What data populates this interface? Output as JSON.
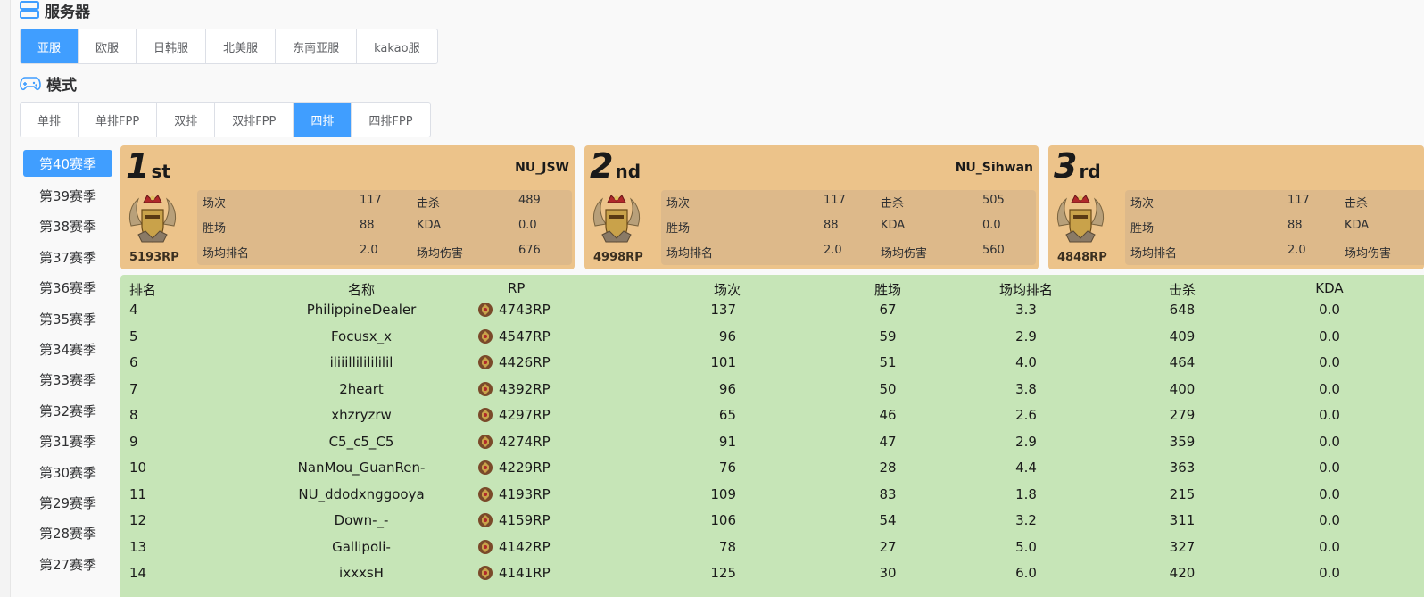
{
  "server": {
    "title": "服务器",
    "icon": "server-icon",
    "options": [
      "亚服",
      "欧服",
      "日韩服",
      "北美服",
      "东南亚服",
      "kakao服"
    ],
    "selected": "亚服"
  },
  "mode": {
    "title": "模式",
    "icon": "gamepad-icon",
    "options": [
      "单排",
      "单排FPP",
      "双排",
      "双排FPP",
      "四排",
      "四排FPP"
    ],
    "selected": "四排"
  },
  "seasons": {
    "items": [
      "第40赛季",
      "第39赛季",
      "第38赛季",
      "第37赛季",
      "第36赛季",
      "第35赛季",
      "第34赛季",
      "第33赛季",
      "第32赛季",
      "第31赛季",
      "第30赛季",
      "第29赛季",
      "第28赛季",
      "第27赛季"
    ],
    "selected": "第40赛季"
  },
  "podium": [
    {
      "place": "1",
      "suffix": "st",
      "name": "NU_JSW",
      "rp": "5193RP",
      "labels": {
        "matches": "场次",
        "wins": "胜场",
        "avg_rank": "场均排名",
        "kills": "击杀",
        "kda": "KDA",
        "avg_damage": "场均伤害"
      },
      "matches": "117",
      "wins": "88",
      "avg_rank": "2.0",
      "kills": "489",
      "kda": "0.0",
      "avg_damage": "676"
    },
    {
      "place": "2",
      "suffix": "nd",
      "name": "NU_Sihwan",
      "rp": "4998RP",
      "labels": {
        "matches": "场次",
        "wins": "胜场",
        "avg_rank": "场均排名",
        "kills": "击杀",
        "kda": "KDA",
        "avg_damage": "场均伤害"
      },
      "matches": "117",
      "wins": "88",
      "avg_rank": "2.0",
      "kills": "505",
      "kda": "0.0",
      "avg_damage": "560"
    },
    {
      "place": "3",
      "suffix": "rd",
      "name": "",
      "rp": "4848RP",
      "labels": {
        "matches": "场次",
        "wins": "胜场",
        "avg_rank": "场均排名",
        "kills": "击杀",
        "kda": "KDA",
        "avg_damage": "场均伤害"
      },
      "matches": "117",
      "wins": "88",
      "avg_rank": "2.0",
      "kills": "",
      "kda": "",
      "avg_damage": ""
    }
  ],
  "table": {
    "headers": {
      "rank": "排名",
      "name": "名称",
      "rp": "RP",
      "matches": "场次",
      "wins": "胜场",
      "avg_rank": "场均排名",
      "kills": "击杀",
      "kda": "KDA"
    },
    "rows": [
      {
        "rank": "4",
        "name": "PhilippineDealer",
        "rp": "4743RP",
        "matches": "137",
        "wins": "67",
        "avg_rank": "3.3",
        "kills": "648",
        "kda": "0.0"
      },
      {
        "rank": "5",
        "name": "Focusx_x",
        "rp": "4547RP",
        "matches": "96",
        "wins": "59",
        "avg_rank": "2.9",
        "kills": "409",
        "kda": "0.0"
      },
      {
        "rank": "6",
        "name": "iliiillililililil",
        "rp": "4426RP",
        "matches": "101",
        "wins": "51",
        "avg_rank": "4.0",
        "kills": "464",
        "kda": "0.0"
      },
      {
        "rank": "7",
        "name": "2heart",
        "rp": "4392RP",
        "matches": "96",
        "wins": "50",
        "avg_rank": "3.8",
        "kills": "400",
        "kda": "0.0"
      },
      {
        "rank": "8",
        "name": "xhzryzrw",
        "rp": "4297RP",
        "matches": "65",
        "wins": "46",
        "avg_rank": "2.6",
        "kills": "279",
        "kda": "0.0"
      },
      {
        "rank": "9",
        "name": "C5_c5_C5",
        "rp": "4274RP",
        "matches": "91",
        "wins": "47",
        "avg_rank": "2.9",
        "kills": "359",
        "kda": "0.0"
      },
      {
        "rank": "10",
        "name": "NanMou_GuanRen-",
        "rp": "4229RP",
        "matches": "76",
        "wins": "28",
        "avg_rank": "4.4",
        "kills": "363",
        "kda": "0.0"
      },
      {
        "rank": "11",
        "name": "NU_ddodxnggooya",
        "rp": "4193RP",
        "matches": "109",
        "wins": "83",
        "avg_rank": "1.8",
        "kills": "215",
        "kda": "0.0"
      },
      {
        "rank": "12",
        "name": "Down-_-",
        "rp": "4159RP",
        "matches": "106",
        "wins": "54",
        "avg_rank": "3.2",
        "kills": "311",
        "kda": "0.0"
      },
      {
        "rank": "13",
        "name": "Gallipoli-",
        "rp": "4142RP",
        "matches": "78",
        "wins": "27",
        "avg_rank": "5.0",
        "kills": "327",
        "kda": "0.0"
      },
      {
        "rank": "14",
        "name": "ixxxsH",
        "rp": "4141RP",
        "matches": "125",
        "wins": "30",
        "avg_rank": "6.0",
        "kills": "420",
        "kda": "0.0"
      }
    ]
  },
  "colors": {
    "accent": "#409eff",
    "podium_bg": "#ecc38a",
    "table_bg": "#c6e5b7"
  }
}
